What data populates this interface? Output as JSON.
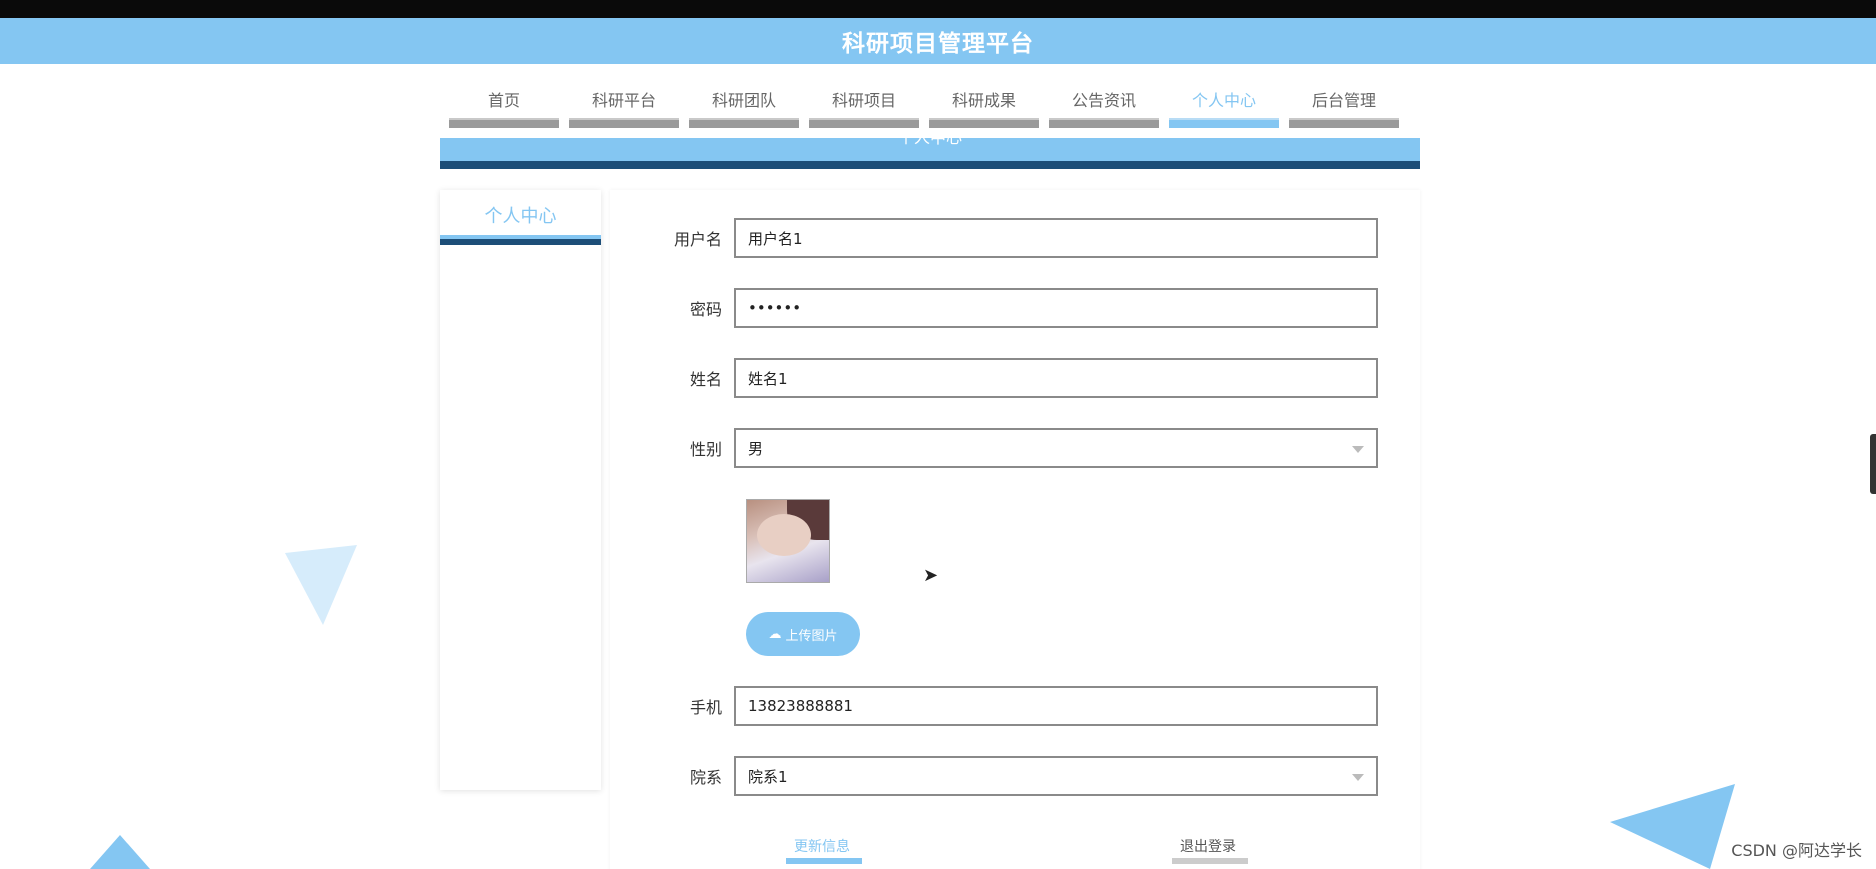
{
  "header": {
    "title": "科研项目管理平台"
  },
  "nav": {
    "items": [
      {
        "label": "首页"
      },
      {
        "label": "科研平台"
      },
      {
        "label": "科研团队"
      },
      {
        "label": "科研项目"
      },
      {
        "label": "科研成果"
      },
      {
        "label": "公告资讯"
      },
      {
        "label": "个人中心"
      },
      {
        "label": "后台管理"
      }
    ],
    "active_index": 6
  },
  "section": {
    "title": "个人中心"
  },
  "sidebar": {
    "items": [
      {
        "label": "个人中心"
      }
    ]
  },
  "form": {
    "username": {
      "label": "用户名",
      "value": "用户名1"
    },
    "password": {
      "label": "密码",
      "value": "••••••"
    },
    "name": {
      "label": "姓名",
      "value": "姓名1"
    },
    "gender": {
      "label": "性别",
      "value": "男"
    },
    "upload_label": "上传图片",
    "phone": {
      "label": "手机",
      "value": "13823888881"
    },
    "department": {
      "label": "院系",
      "value": "院系1"
    },
    "update_label": "更新信息",
    "logout_label": "退出登录"
  },
  "watermark": "CSDN @阿达学长",
  "colors": {
    "accent": "#84c6f2",
    "dark_accent": "#1d4e78",
    "nav_bar": "#9a9a9a"
  }
}
